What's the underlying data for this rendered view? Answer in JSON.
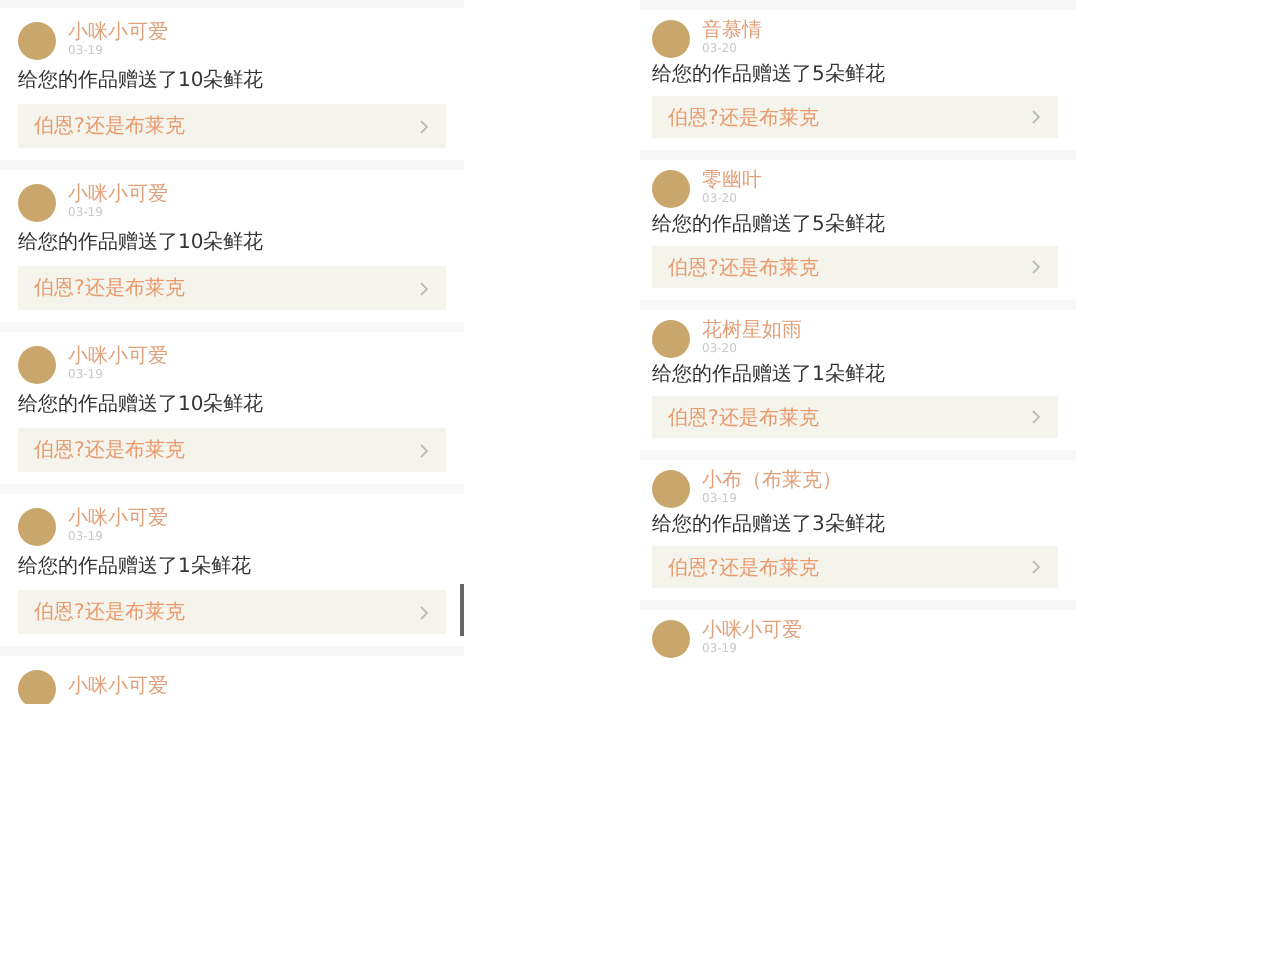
{
  "panels": [
    {
      "scrollbar": true,
      "cards": [
        {
          "name": "小咪小可爱",
          "date": "03-19",
          "message": "给您的作品赠送了10朵鲜花",
          "link": "伯恩?还是布莱克"
        },
        {
          "name": "小咪小可爱",
          "date": "03-19",
          "message": "给您的作品赠送了10朵鲜花",
          "link": "伯恩?还是布莱克"
        },
        {
          "name": "小咪小可爱",
          "date": "03-19",
          "message": "给您的作品赠送了10朵鲜花",
          "link": "伯恩?还是布莱克"
        },
        {
          "name": "小咪小可爱",
          "date": "03-19",
          "message": "给您的作品赠送了1朵鲜花",
          "link": "伯恩?还是布莱克"
        },
        {
          "name": "小咪小可爱"
        }
      ]
    },
    {
      "cards": [
        {
          "name": "音慕情",
          "date": "03-20",
          "message": "给您的作品赠送了5朵鲜花",
          "link": "伯恩?还是布莱克"
        },
        {
          "name": "零幽叶",
          "date": "03-20",
          "message": "给您的作品赠送了5朵鲜花",
          "link": "伯恩?还是布莱克"
        },
        {
          "name": "花树星如雨",
          "date": "03-20",
          "message": "给您的作品赠送了1朵鲜花",
          "link": "伯恩?还是布莱克"
        },
        {
          "name": "小布（布莱克）",
          "date": "03-19",
          "message": "给您的作品赠送了3朵鲜花",
          "link": "伯恩?还是布莱克"
        },
        {
          "name": "小咪小可爱",
          "date": "03-19"
        }
      ]
    }
  ]
}
